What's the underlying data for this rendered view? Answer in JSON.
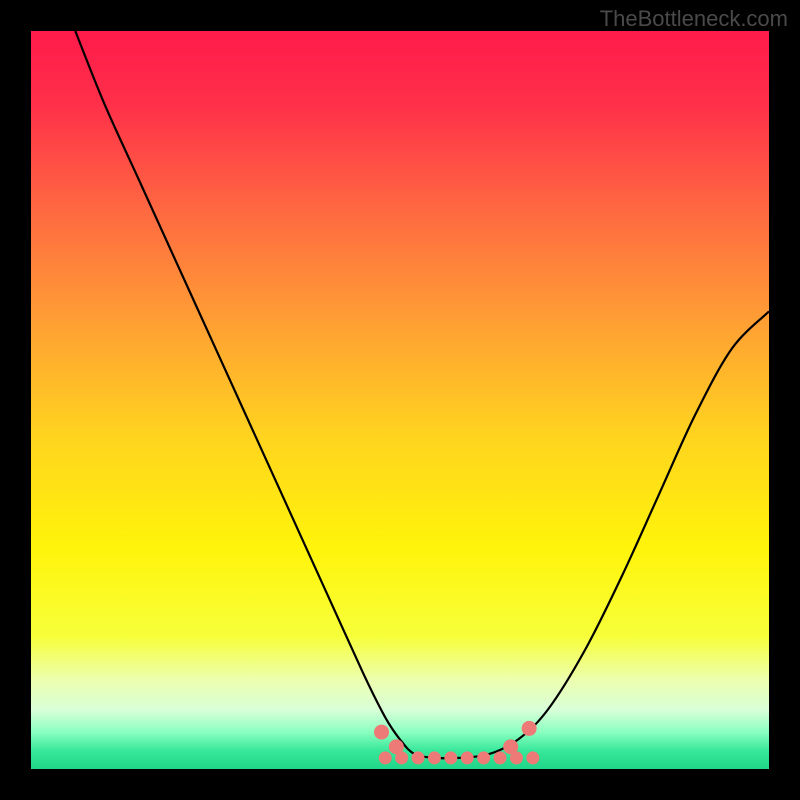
{
  "watermark": "TheBottleneck.com",
  "chart_data": {
    "type": "line",
    "title": "",
    "xlabel": "",
    "ylabel": "",
    "xlim": [
      0,
      100
    ],
    "ylim": [
      0,
      100
    ],
    "series": [
      {
        "name": "curve",
        "x": [
          6,
          10,
          15,
          20,
          25,
          30,
          35,
          40,
          45,
          48,
          50,
          52,
          55,
          58,
          62,
          66,
          70,
          75,
          80,
          85,
          90,
          95,
          100
        ],
        "y": [
          100,
          90,
          79,
          68,
          57,
          46,
          35,
          24,
          13,
          7,
          4,
          2,
          1.5,
          1.5,
          2,
          4,
          8,
          16,
          26,
          37,
          48,
          57,
          62
        ]
      }
    ],
    "markers": {
      "name": "highlight-dots",
      "color": "#ed7a76",
      "x_range": [
        48,
        68
      ],
      "y_level": 1.5,
      "edge_points": [
        [
          47.5,
          5
        ],
        [
          49.5,
          3
        ],
        [
          65,
          3
        ],
        [
          67.5,
          5.5
        ]
      ]
    },
    "gradient": {
      "stops": [
        {
          "offset": 0.0,
          "color": "#ff1a4a"
        },
        {
          "offset": 0.1,
          "color": "#ff3049"
        },
        {
          "offset": 0.25,
          "color": "#ff6b41"
        },
        {
          "offset": 0.4,
          "color": "#ffa133"
        },
        {
          "offset": 0.55,
          "color": "#ffd41f"
        },
        {
          "offset": 0.7,
          "color": "#fff40a"
        },
        {
          "offset": 0.82,
          "color": "#f7ff3a"
        },
        {
          "offset": 0.88,
          "color": "#ecffb0"
        },
        {
          "offset": 0.92,
          "color": "#d8ffd8"
        },
        {
          "offset": 0.95,
          "color": "#8affc0"
        },
        {
          "offset": 0.975,
          "color": "#38e89a"
        },
        {
          "offset": 1.0,
          "color": "#1fd688"
        }
      ]
    }
  }
}
